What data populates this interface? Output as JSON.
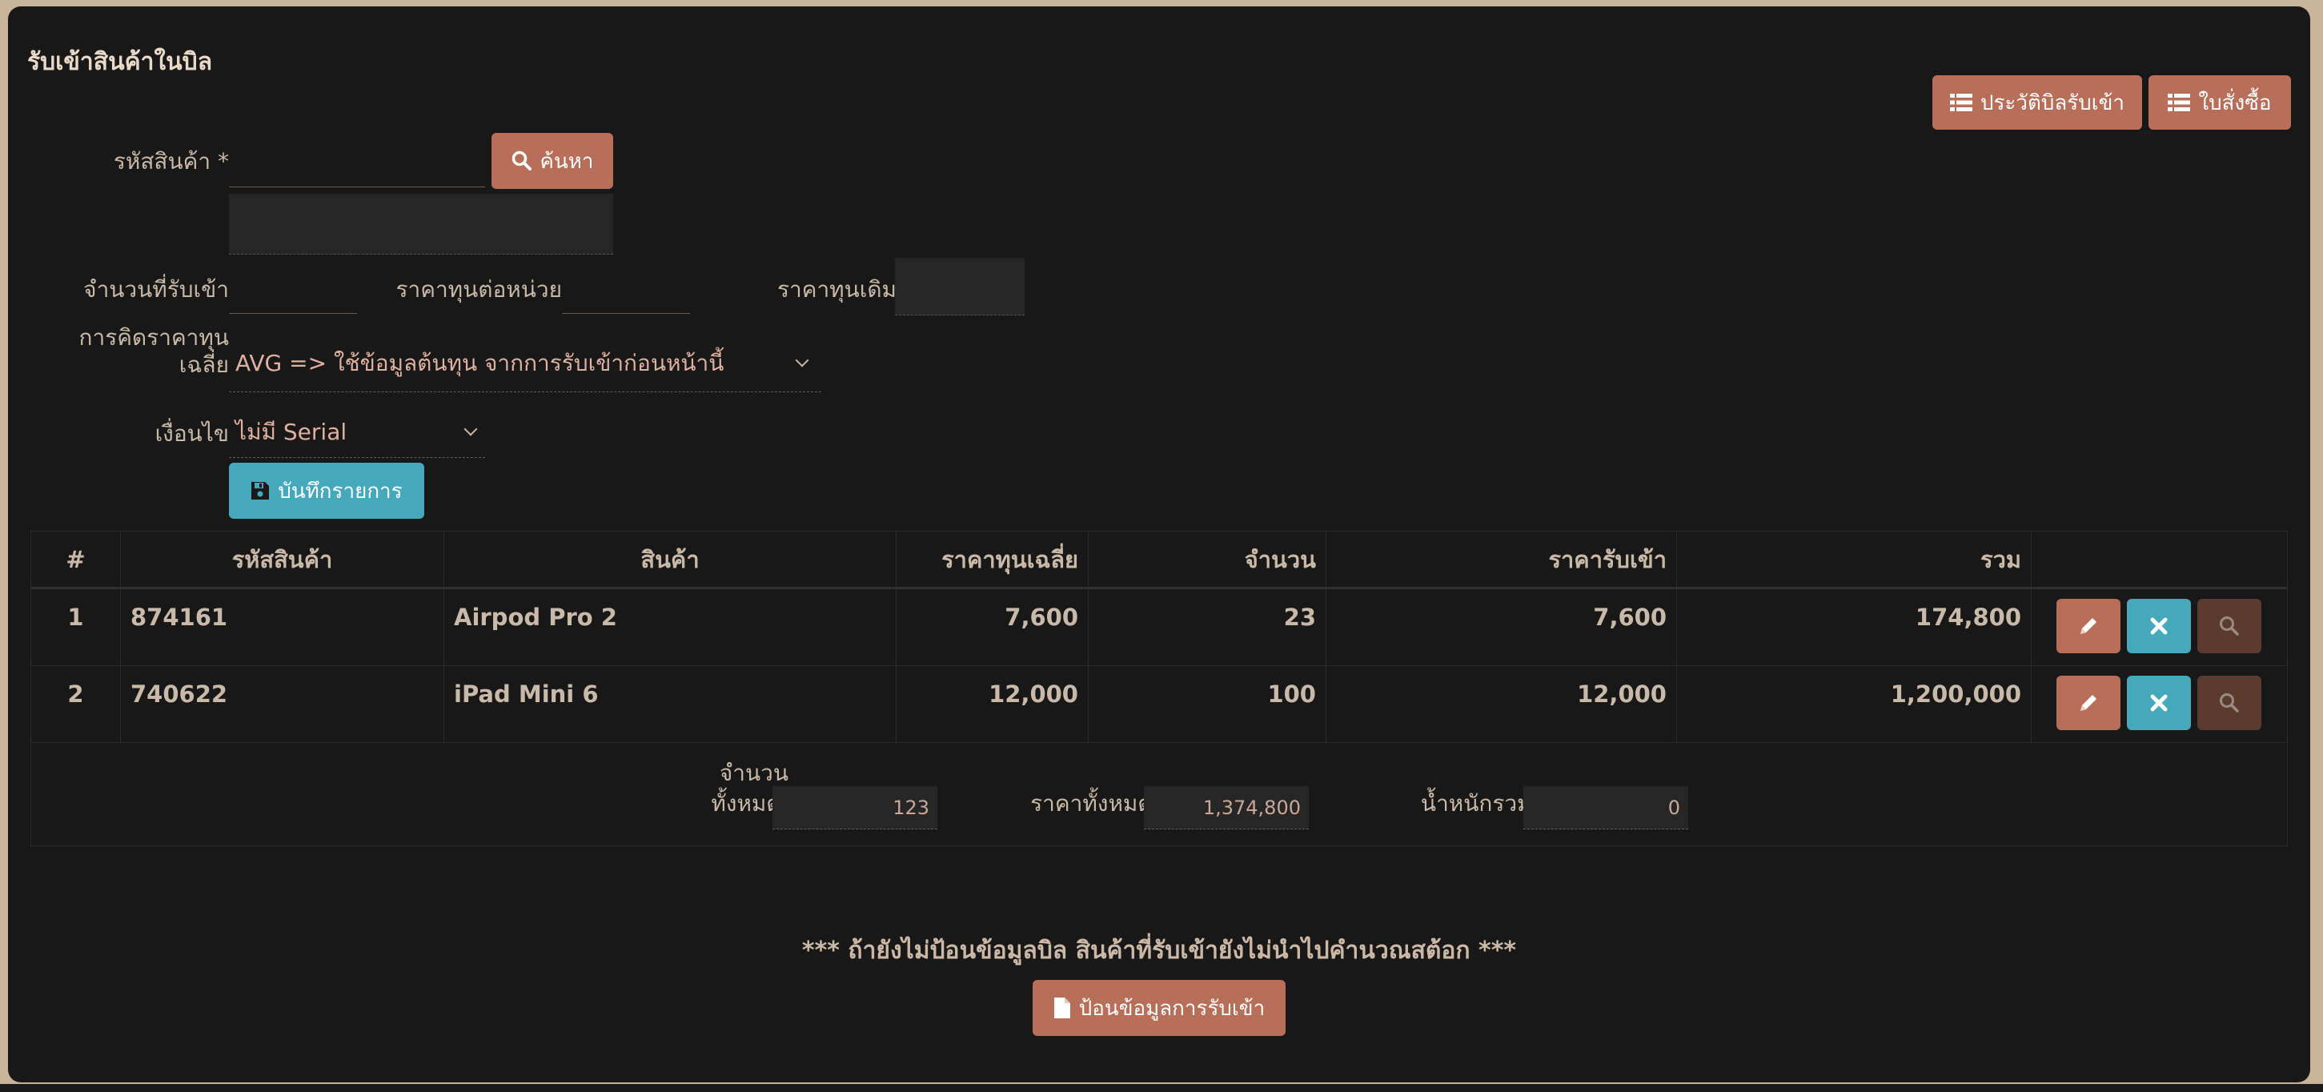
{
  "page": {
    "title": "รับเข้าสินค้าในบิล"
  },
  "top_buttons": {
    "history_label": "ประวัติบิลรับเข้า",
    "po_label": "ใบสั่งซื้อ"
  },
  "form": {
    "product_code_label": "รหัสสินค้า *",
    "product_code_value": "",
    "search_label": "ค้นหา",
    "product_name_value": "",
    "qty_label": "จำนวนที่รับเข้า",
    "qty_value": "",
    "unit_cost_label": "ราคาทุนต่อหน่วย",
    "unit_cost_value": "",
    "prev_cost_label": "ราคาทุนเดิม",
    "prev_cost_value": "",
    "avg_method_label_line1": "การคิดราคาทุน",
    "avg_method_label_line2": "เฉลี่ย",
    "avg_method_selected": "AVG => ใช้ข้อมูลต้นทุน จากการรับเข้าก่อนหน้านี้",
    "condition_label": "เงื่อนไข",
    "condition_selected": "ไม่มี Serial",
    "save_label": "บันทึกรายการ"
  },
  "table": {
    "headers": [
      "#",
      "รหัสสินค้า",
      "สินค้า",
      "ราคาทุนเฉลี่ย",
      "จำนวน",
      "ราคารับเข้า",
      "รวม"
    ],
    "rows": [
      {
        "idx": "1",
        "code": "874161",
        "name": "Airpod Pro 2",
        "avg_cost": "7,600",
        "qty": "23",
        "price": "7,600",
        "total": "174,800"
      },
      {
        "idx": "2",
        "code": "740622",
        "name": "iPad Mini 6",
        "avg_cost": "12,000",
        "qty": "100",
        "price": "12,000",
        "total": "1,200,000"
      }
    ]
  },
  "summary": {
    "total_qty_label_line1": "จำนวน",
    "total_qty_label_line2": "ทั้งหมด:",
    "total_qty_value": "123",
    "total_price_label": "ราคาทั้งหมด:",
    "total_price_value": "1,374,800",
    "total_weight_label": "น้ำหนักรวม:",
    "total_weight_value": "0"
  },
  "footer": {
    "warning": "*** ถ้ายังไม่ป้อนข้อมูลบิล สินค้าที่รับเข้ายังไม่นำไปคำนวณสต้อก ***",
    "enter_bill_label": "ป้อนข้อมูลการรับเข้า"
  },
  "colors": {
    "accent_brown": "#b86f5a",
    "accent_teal": "#45a9bb",
    "dark_brown": "#5b3b2d",
    "panel_bg": "#181818"
  }
}
